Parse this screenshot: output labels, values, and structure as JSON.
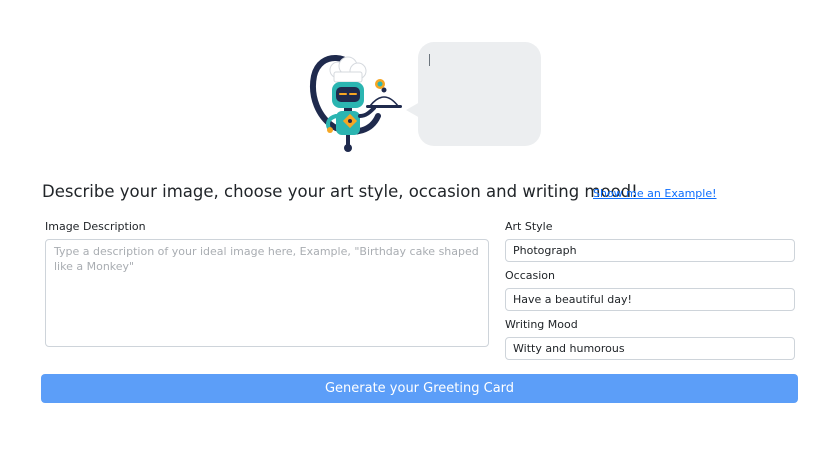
{
  "hero": {
    "mascot_icon": "robot-waiter-icon",
    "bubble_text": ""
  },
  "form": {
    "heading": "Describe your image, choose your art style, occasion and writing mood!",
    "example_link": "Show me an Example!",
    "image_description": {
      "label": "Image Description",
      "value": "",
      "placeholder": "Type a description of your ideal image here, Example, \"Birthday cake shaped like a Monkey\""
    },
    "art_style": {
      "label": "Art Style",
      "value": "Photograph"
    },
    "occasion": {
      "label": "Occasion",
      "value": "Have a beautiful day!"
    },
    "writing_mood": {
      "label": "Writing Mood",
      "value": "Witty and humorous"
    },
    "submit_label": "Generate your Greeting Card"
  },
  "colors": {
    "primary_button": "#5c9ef8",
    "link": "#0d6efd",
    "bubble": "#eceef0",
    "mascot_body": "#2bb5b1",
    "mascot_dark": "#1f2a4d",
    "mascot_accent": "#f5a623"
  }
}
